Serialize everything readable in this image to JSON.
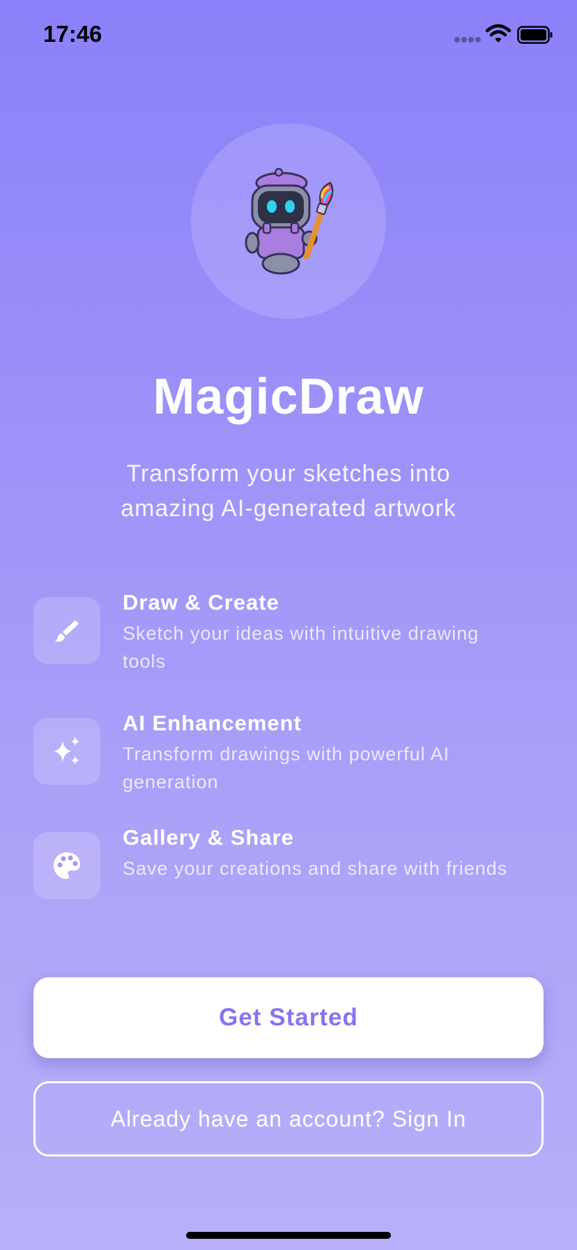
{
  "status_bar": {
    "time": "17:46",
    "icons": [
      "signal-dots-icon",
      "wifi-icon",
      "battery-icon"
    ]
  },
  "hero": {
    "illustration": "robot-painter-icon"
  },
  "app": {
    "title": "MagicDraw",
    "subtitle_line1": "Transform your sketches into",
    "subtitle_line2": "amazing AI-generated artwork"
  },
  "features": [
    {
      "icon": "paintbrush-icon",
      "title": "Draw & Create",
      "desc_line1": "Sketch your ideas with intuitive drawing",
      "desc_line2": "tools"
    },
    {
      "icon": "sparkles-icon",
      "title": "AI Enhancement",
      "desc_line1": "Transform drawings with powerful AI",
      "desc_line2": "generation"
    },
    {
      "icon": "palette-icon",
      "title": "Gallery & Share",
      "desc_line1": "Save your creations and share with friends"
    }
  ],
  "actions": {
    "primary_label": "Get Started",
    "secondary_label": "Already have an account? Sign In"
  },
  "colors": {
    "background_top": "#8b80f9",
    "background_bottom": "#b8b0f8",
    "accent": "#8575ef",
    "robot_purple": "#a87ee0"
  }
}
